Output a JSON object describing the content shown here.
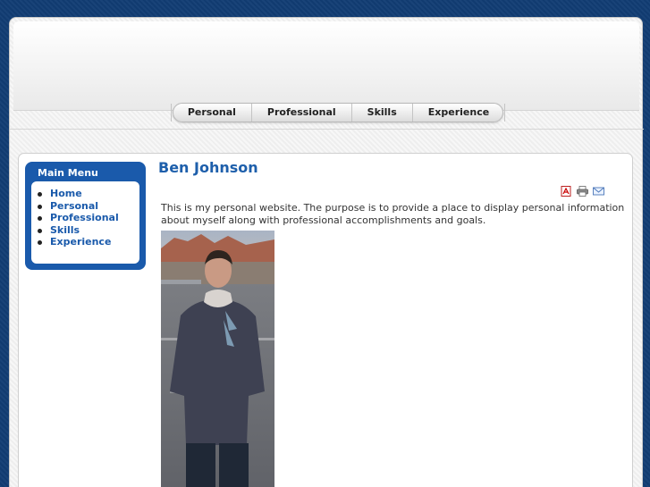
{
  "topnav": {
    "items": [
      {
        "label": "Personal"
      },
      {
        "label": "Professional"
      },
      {
        "label": "Skills"
      },
      {
        "label": "Experience"
      }
    ]
  },
  "menu": {
    "title": "Main Menu",
    "items": [
      {
        "label": "Home"
      },
      {
        "label": "Personal"
      },
      {
        "label": "Professional"
      },
      {
        "label": "Skills"
      },
      {
        "label": "Experience"
      }
    ]
  },
  "article": {
    "title": "Ben Johnson",
    "body": "This is my personal website. The purpose is to provide a place to display personal information about myself along with professional accomplishments and goals.",
    "tools": [
      {
        "icon": "pdf-icon"
      },
      {
        "icon": "print-icon"
      },
      {
        "icon": "email-icon"
      }
    ]
  },
  "colors": {
    "background": "#123d74",
    "accent": "#1a5aab",
    "title": "#1e5fab"
  }
}
